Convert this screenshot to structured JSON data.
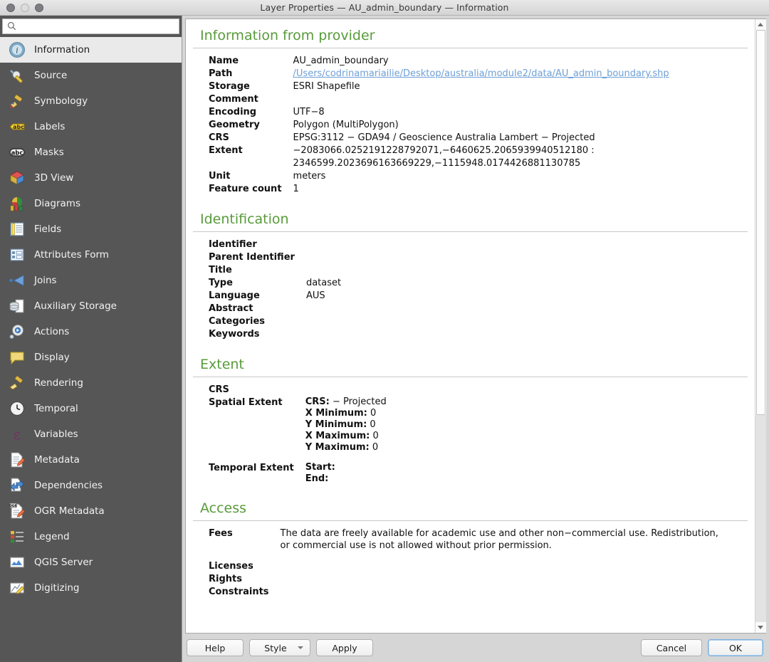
{
  "window": {
    "title": "Layer Properties — AU_admin_boundary — Information",
    "traffic_lights": [
      "close-button",
      "minimize-button",
      "zoom-button"
    ]
  },
  "sidebar": {
    "search": {
      "value": "",
      "placeholder": ""
    },
    "items": [
      {
        "label": "Information",
        "icon": "info-icon",
        "selected": true
      },
      {
        "label": "Source",
        "icon": "source-icon",
        "selected": false
      },
      {
        "label": "Symbology",
        "icon": "symbology-icon",
        "selected": false
      },
      {
        "label": "Labels",
        "icon": "labels-abc-icon",
        "selected": false
      },
      {
        "label": "Masks",
        "icon": "masks-abc-icon",
        "selected": false
      },
      {
        "label": "3D View",
        "icon": "cube-3d-icon",
        "selected": false
      },
      {
        "label": "Diagrams",
        "icon": "diagrams-icon",
        "selected": false
      },
      {
        "label": "Fields",
        "icon": "fields-icon",
        "selected": false
      },
      {
        "label": "Attributes Form",
        "icon": "attributes-form-icon",
        "selected": false
      },
      {
        "label": "Joins",
        "icon": "joins-icon",
        "selected": false
      },
      {
        "label": "Auxiliary Storage",
        "icon": "database-icon",
        "selected": false
      },
      {
        "label": "Actions",
        "icon": "actions-gear-icon",
        "selected": false
      },
      {
        "label": "Display",
        "icon": "display-balloon-icon",
        "selected": false
      },
      {
        "label": "Rendering",
        "icon": "rendering-brush-icon",
        "selected": false
      },
      {
        "label": "Temporal",
        "icon": "clock-icon",
        "selected": false
      },
      {
        "label": "Variables",
        "icon": "variables-epsilon-icon",
        "selected": false
      },
      {
        "label": "Metadata",
        "icon": "metadata-icon",
        "selected": false
      },
      {
        "label": "Dependencies",
        "icon": "dependencies-icon",
        "selected": false
      },
      {
        "label": "OGR Metadata",
        "icon": "ogr-metadata-icon",
        "selected": false
      },
      {
        "label": "Legend",
        "icon": "legend-icon",
        "selected": false
      },
      {
        "label": "QGIS Server",
        "icon": "qgis-server-icon",
        "selected": false
      },
      {
        "label": "Digitizing",
        "icon": "digitizing-icon",
        "selected": false
      }
    ]
  },
  "content": {
    "provider": {
      "heading": "Information from provider",
      "name_label": "Name",
      "name_value": "AU_admin_boundary",
      "path_label": "Path",
      "path_value": "/Users/codrinamariailie/Desktop/australia/module2/data/AU_admin_boundary.shp",
      "storage_label": "Storage",
      "storage_value": "ESRI Shapefile",
      "comment_label": "Comment",
      "comment_value": "",
      "encoding_label": "Encoding",
      "encoding_value": "UTF−8",
      "geometry_label": "Geometry",
      "geometry_value": "Polygon (MultiPolygon)",
      "crs_label": "CRS",
      "crs_value": "EPSG:3112 − GDA94 / Geoscience Australia Lambert − Projected",
      "extent_label": "Extent",
      "extent_line1": "−2083066.0252191228792071,−6460625.2065939940512180 :",
      "extent_line2": "2346599.2023696163669229,−1115948.0174426881130785",
      "unit_label": "Unit",
      "unit_value": "meters",
      "feature_count_label": "Feature count",
      "feature_count_value": "1"
    },
    "identification": {
      "heading": "Identification",
      "rows": [
        {
          "label": "Identifier",
          "value": ""
        },
        {
          "label": "Parent Identifier",
          "value": ""
        },
        {
          "label": "Title",
          "value": ""
        },
        {
          "label": "Type",
          "value": "dataset"
        },
        {
          "label": "Language",
          "value": "AUS"
        },
        {
          "label": "Abstract",
          "value": ""
        },
        {
          "label": "Categories",
          "value": ""
        },
        {
          "label": "Keywords",
          "value": ""
        }
      ]
    },
    "extent": {
      "heading": "Extent",
      "crs_label": "CRS",
      "crs_value": "",
      "spatial_label": "Spatial Extent",
      "spatial_crs_key": "CRS:",
      "spatial_crs_val": "− Projected",
      "x_min_key": "X Minimum:",
      "x_min_val": "0",
      "y_min_key": "Y Minimum:",
      "y_min_val": "0",
      "x_max_key": "X Maximum:",
      "x_max_val": "0",
      "y_max_key": "Y Maximum:",
      "y_max_val": "0",
      "temporal_label": "Temporal Extent",
      "start_key": "Start:",
      "start_val": "",
      "end_key": "End:",
      "end_val": ""
    },
    "access": {
      "heading": "Access",
      "fees_label": "Fees",
      "fees_value": "The data are freely available for academic use and other non−commercial use. Redistribution, or commercial use is not allowed without prior permission.",
      "licenses_label": "Licenses",
      "licenses_value": "",
      "rights_label": "Rights",
      "rights_value": "",
      "constraints_label": "Constraints",
      "constraints_value": ""
    }
  },
  "buttons": {
    "help": "Help",
    "style": "Style",
    "apply": "Apply",
    "cancel": "Cancel",
    "ok": "OK"
  },
  "colors": {
    "heading_green": "#589b3a",
    "link_blue": "#6d9fd6",
    "sidebar_bg": "#565656",
    "selected_bg": "#eaeaea"
  }
}
